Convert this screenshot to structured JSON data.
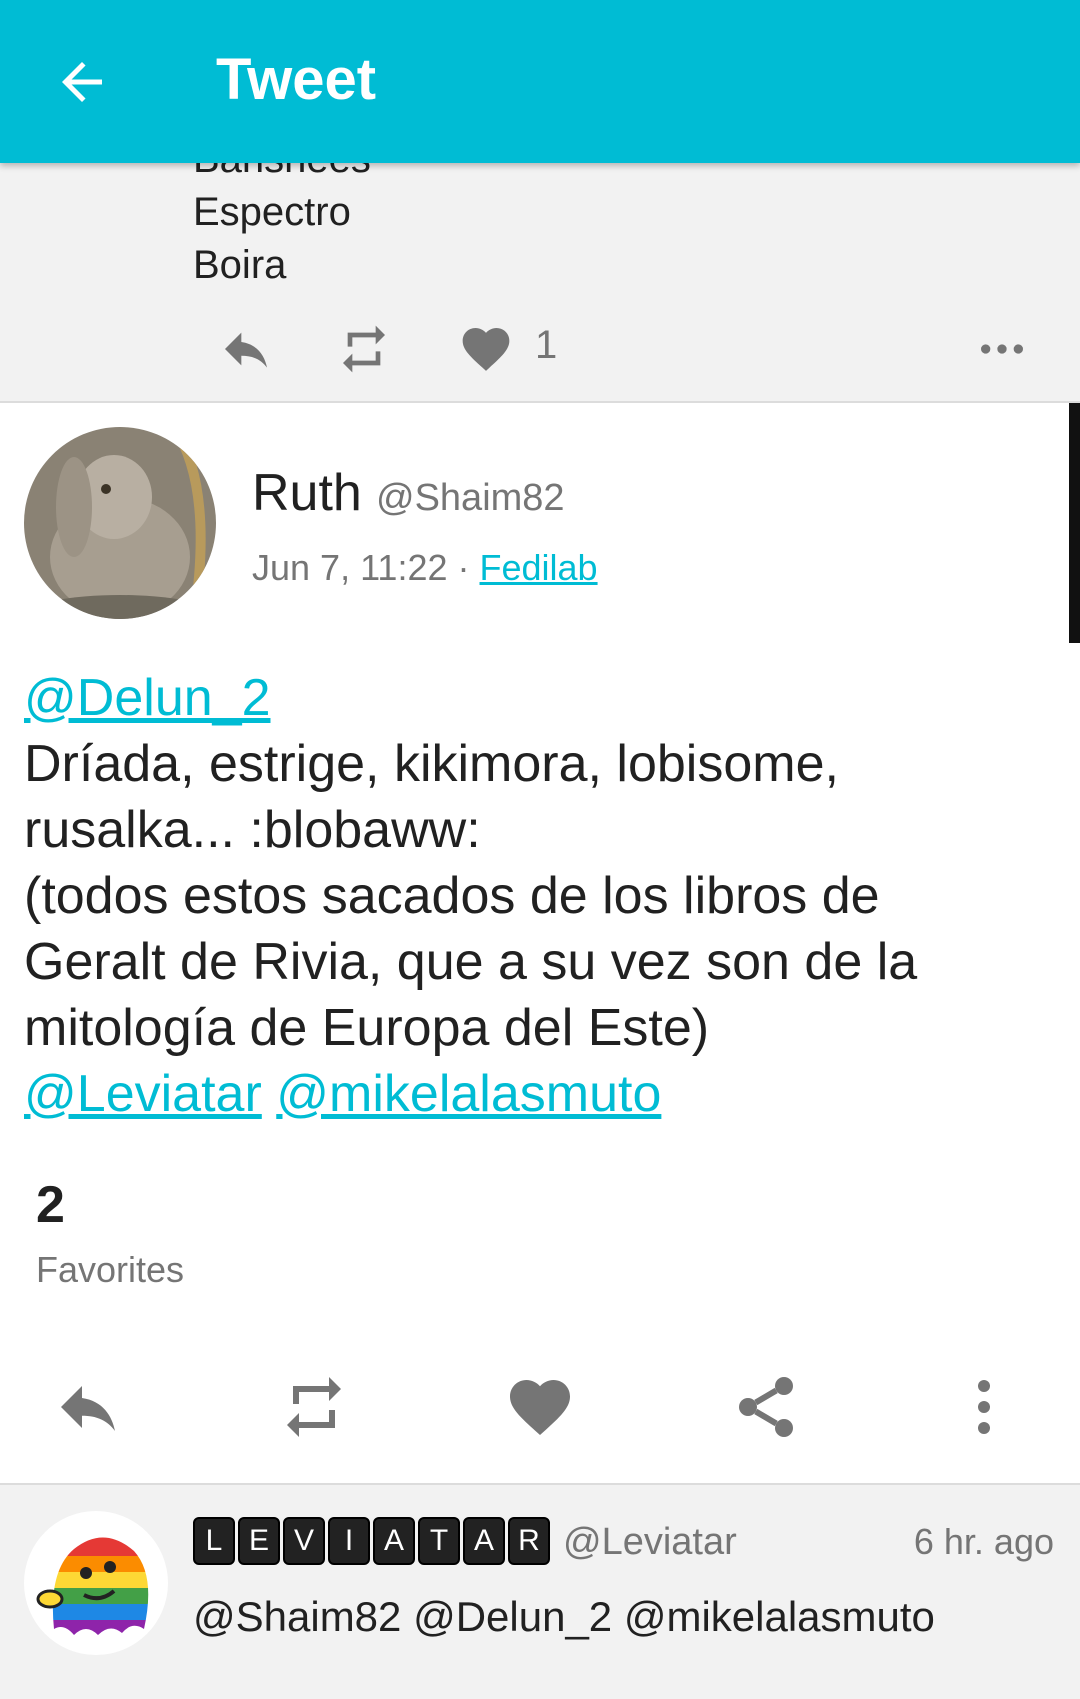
{
  "appbar": {
    "title": "Tweet",
    "back_icon": "arrow-left-icon",
    "bg_color": "#00bcd4"
  },
  "prev_status": {
    "lines": [
      "Banshees",
      "Espectro",
      "Boira"
    ],
    "favorites_count": "1"
  },
  "status": {
    "display_name": "Ruth",
    "acct": "@Shaim82",
    "date": "Jun 7, 11:22 ·",
    "application": "Fedilab",
    "mention_start": "@Delun_2",
    "body": [
      "Dríada, estrige, kikimora, lobisome,",
      "rusalka... :blobaww:",
      "(todos estos sacados de los libros de",
      "Geralt de Rivia, que a su vez son de la",
      "mitología de Europa del Este)"
    ],
    "mention_end_1": "@Leviatar",
    "mention_end_2": "@mikelalasmuto",
    "favorites_count": "2",
    "favorites_label": "Favorites"
  },
  "reply": {
    "display_name_letters": [
      "L",
      "E",
      "V",
      "I",
      "A",
      "T",
      "A",
      "R"
    ],
    "acct": "@Leviatar",
    "time": "6 hr. ago",
    "text": "@Shaim82 @Delun_2 @mikelalasmuto"
  },
  "colors": {
    "accent": "#00bcd4",
    "icon_gray": "#757575",
    "text": "#212121"
  }
}
